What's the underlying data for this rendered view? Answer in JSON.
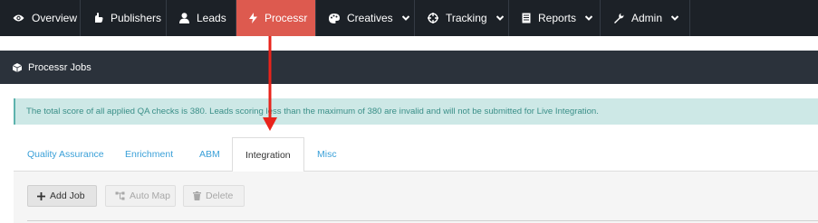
{
  "nav": {
    "items": [
      {
        "label": "Overview",
        "icon": "eye-icon"
      },
      {
        "label": "Publishers",
        "icon": "hand-icon"
      },
      {
        "label": "Leads",
        "icon": "user-icon"
      },
      {
        "label": "Processr",
        "icon": "bolt-icon",
        "active": true
      },
      {
        "label": "Creatives",
        "icon": "palette-icon",
        "dropdown": true
      },
      {
        "label": "Tracking",
        "icon": "crosshair-icon",
        "dropdown": true
      },
      {
        "label": "Reports",
        "icon": "document-icon",
        "dropdown": true
      },
      {
        "label": "Admin",
        "icon": "wrench-icon",
        "dropdown": true
      }
    ]
  },
  "subbar": {
    "title": "Processr Jobs",
    "icon": "cubes-icon"
  },
  "alert": {
    "text": "The total score of all applied QA checks is 380. Leads scoring less than the maximum of 380 are invalid and will not be submitted for Live Integration."
  },
  "tabs": [
    {
      "label": "Quality Assurance"
    },
    {
      "label": "Enrichment"
    },
    {
      "label": "ABM"
    },
    {
      "label": "Integration",
      "active": true
    },
    {
      "label": "Misc"
    }
  ],
  "toolbar": {
    "add_job": "Add Job",
    "auto_map": "Auto Map",
    "delete": "Delete"
  },
  "colors": {
    "nav_bg": "#1c2127",
    "active_tab": "#dd5a4f",
    "subbar_bg": "#2b323b",
    "alert_bg": "#cde8e6",
    "alert_text": "#3a8f88",
    "link": "#3aa0d8",
    "annotation_arrow": "#e8231b"
  }
}
